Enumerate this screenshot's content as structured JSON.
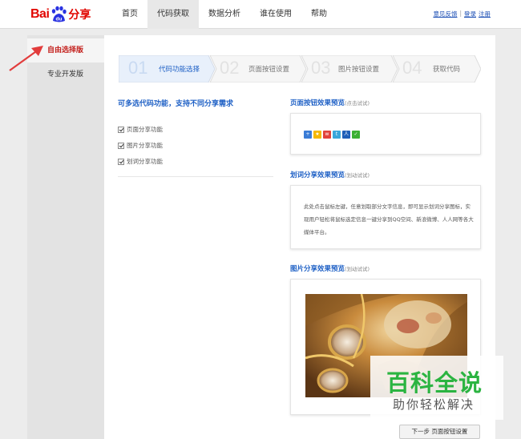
{
  "header": {
    "logo": {
      "bai": "Bai",
      "du": "du",
      "fenxiang": "分享"
    },
    "nav": [
      "首页",
      "代码获取",
      "数据分析",
      "谁在使用",
      "帮助"
    ],
    "links": {
      "feedback": "意见反馈",
      "login": "登录",
      "register": "注册",
      "sep": "|"
    }
  },
  "sidebar": {
    "items": [
      {
        "label": "自由选择版",
        "active": true
      },
      {
        "label": "专业开发版",
        "active": false
      }
    ]
  },
  "steps": [
    {
      "num": "01",
      "label": "代码功能选择",
      "active": true
    },
    {
      "num": "02",
      "label": "页面按钮设置",
      "active": false
    },
    {
      "num": "03",
      "label": "图片按钮设置",
      "active": false
    },
    {
      "num": "04",
      "label": "获取代码",
      "active": false
    }
  ],
  "left": {
    "title": "可多选代码功能，支持不同分享需求",
    "options": [
      {
        "label": "页面分享功能",
        "checked": true
      },
      {
        "label": "图片分享功能",
        "checked": true
      },
      {
        "label": "划词分享功能",
        "checked": true
      }
    ]
  },
  "preview": {
    "page_buttons": {
      "title": "页面按钮效果预览",
      "hint": "(点击试试)"
    },
    "share_icons": [
      {
        "name": "more-icon",
        "glyph": "+",
        "color": "#3a7cd6"
      },
      {
        "name": "qzone-icon",
        "glyph": "★",
        "color": "#f5b800"
      },
      {
        "name": "weibo-icon",
        "glyph": "w",
        "color": "#e2433b"
      },
      {
        "name": "tencent-weibo-icon",
        "glyph": "t",
        "color": "#39a7db"
      },
      {
        "name": "renren-icon",
        "glyph": "人",
        "color": "#1f5fb8"
      },
      {
        "name": "wechat-icon",
        "glyph": "✓",
        "color": "#3cb034"
      }
    ],
    "text_share": {
      "title": "划词分享效果预览",
      "hint": "(划动试试)",
      "body": "此处点击鼠标左键，任意划取部分文字信息，即可显示划词分享图标，实现用户轻松将鼠标选定信息一键分享到QQ空间、新浪微博、人人网等各大媒体平台。"
    },
    "image_share": {
      "title": "图片分享效果预览",
      "hint": "(划动试试)"
    }
  },
  "watermark": {
    "line1": "百科全说",
    "line2": "助你轻松解决"
  },
  "next_button": "下一步 页面按钮设置",
  "colors": {
    "brand_red": "#e10601",
    "link_blue": "#2162c6",
    "watermark_green": "#2bb441"
  }
}
